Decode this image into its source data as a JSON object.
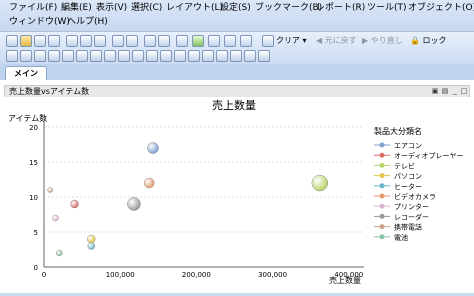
{
  "menubar": {
    "items": [
      {
        "label": "ファイル(F)"
      },
      {
        "label": "編集(E)"
      },
      {
        "label": "表示(V)"
      },
      {
        "label": "選択(C)"
      },
      {
        "label": "レイアウト(L)"
      },
      {
        "label": "設定(S)"
      },
      {
        "label": "ブックマーク(B)"
      },
      {
        "label": "レポート(R)"
      },
      {
        "label": "ツール(T)"
      },
      {
        "label": "オブジェクト(O)"
      },
      {
        "label": "ウィンドウ(W)"
      },
      {
        "label": "ヘルプ(H)"
      }
    ]
  },
  "toolbar": {
    "clear_label": "クリア",
    "back_label": "元に戻す",
    "redo_label": "やり直し",
    "lock_label": "ロック"
  },
  "tabs": [
    {
      "label": "メイン"
    }
  ],
  "panel": {
    "title": "売上数量vsアイテム数"
  },
  "chart_data": {
    "type": "scatter",
    "title": "売上数量",
    "xlabel": "売上数量",
    "ylabel": "アイテム数",
    "xlim": [
      0,
      420000
    ],
    "ylim": [
      0,
      20
    ],
    "x_ticks": [
      "0",
      "100,000",
      "200,000",
      "300,000",
      "400,000"
    ],
    "y_ticks": [
      "0",
      "5",
      "10",
      "15",
      "20"
    ],
    "grid": true,
    "legend_title": "製品大分類名",
    "legend_position": "right",
    "series": [
      {
        "name": "エアコン",
        "color": "#7f9fcf",
        "x": 143000,
        "y": 17,
        "size": 9
      },
      {
        "name": "オーディオプレーヤー",
        "color": "#d9706a",
        "x": 40000,
        "y": 9,
        "size": 6
      },
      {
        "name": "テレビ",
        "color": "#b7d36b",
        "x": 362000,
        "y": 12,
        "size": 14
      },
      {
        "name": "パソコン",
        "color": "#e6c547",
        "x": 62000,
        "y": 4,
        "size": 6
      },
      {
        "name": "ヒーター",
        "color": "#6ab4c9",
        "x": 62000,
        "y": 3,
        "size": 5
      },
      {
        "name": "ビデオカメラ",
        "color": "#e59a6c",
        "x": 138000,
        "y": 12,
        "size": 8
      },
      {
        "name": "プリンター",
        "color": "#ddb3d6",
        "x": 15000,
        "y": 7,
        "size": 4
      },
      {
        "name": "レコーダー",
        "color": "#9a9a9a",
        "x": 118000,
        "y": 9,
        "size": 11
      },
      {
        "name": "携帯電話",
        "color": "#c8a58a",
        "x": 8000,
        "y": 11,
        "size": 3
      },
      {
        "name": "電池",
        "color": "#8bc7a7",
        "x": 20000,
        "y": 2,
        "size": 4
      }
    ]
  }
}
